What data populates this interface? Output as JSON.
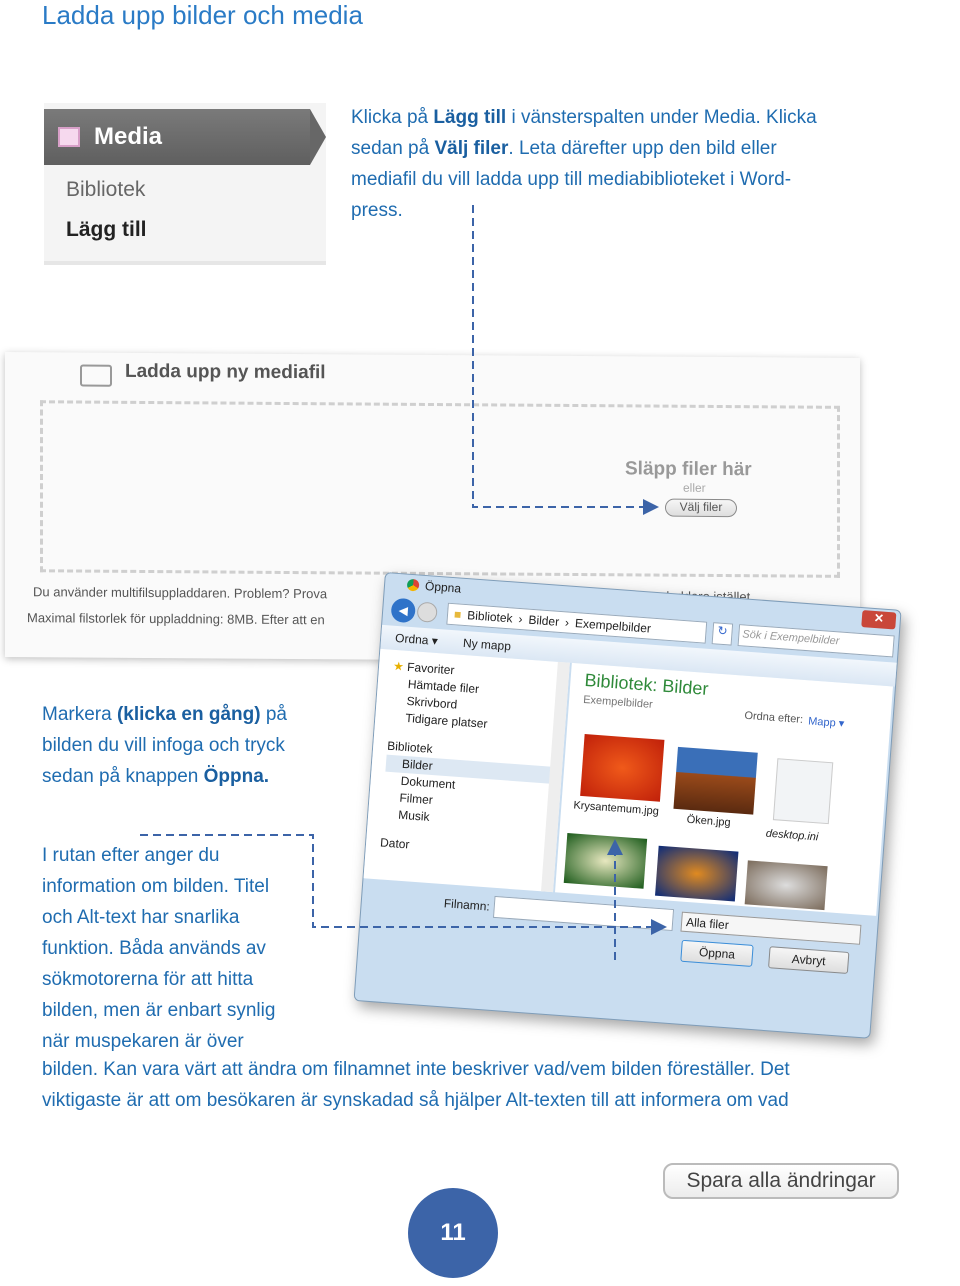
{
  "title": "Ladda upp bilder och media",
  "media_menu": {
    "header": "Media",
    "items": [
      "Bibliotek",
      "Lägg till"
    ]
  },
  "intro": {
    "t1": "Klicka på ",
    "b1": "Lägg till",
    "t2": " i vänsterspalten under Media. Klicka sedan på ",
    "b2": "Välj filer",
    "t3": ". Leta därefter upp den bild eller mediafil du vill ladda upp till mediabiblioteket i Word-press."
  },
  "upload": {
    "title": "Ladda upp ny mediafil",
    "drop": "Släpp filer här",
    "or": "eller",
    "select_button": "Välj filer",
    "note1": "Du använder multifilsuppladdaren. Problem? Prova",
    "note1_end": "...rens uppladdare istället.",
    "note2": "Maximal filstorlek för uppladdning: 8MB. Efter att en"
  },
  "dialog": {
    "title": "Öppna",
    "breadcrumb": [
      "Bibliotek",
      "Bilder",
      "Exempelbilder"
    ],
    "organize": "Ordna ▾",
    "new_folder": "Ny mapp",
    "search_placeholder": "Sök i Exempelbilder",
    "nav": {
      "favorites": "Favoriter",
      "fav_items": [
        "Hämtade filer",
        "Skrivbord",
        "Tidigare platser"
      ],
      "libraries": "Bibliotek",
      "lib_items": [
        "Bilder",
        "Dokument",
        "Filmer",
        "Musik"
      ],
      "computer": "Dator"
    },
    "library_title": "Bibliotek: Bilder",
    "library_sub": "Exempelbilder",
    "sort_label": "Ordna efter:",
    "sort_value": "Mapp ▾",
    "files": [
      "Krysantemum.jpg",
      "Öken.jpg",
      "desktop.ini"
    ],
    "filename_label": "Filnamn:",
    "filetype": "Alla filer",
    "open_button": "Öppna",
    "cancel_button": "Avbryt"
  },
  "step2": {
    "t1": "Markera ",
    "b1": "(klicka en gång)",
    "t2": " på bilden du vill infoga och tryck sedan på knappen ",
    "b2": "Öppna."
  },
  "step3": {
    "lines": [
      "I rutan efter anger du",
      "information om bilden. Titel",
      "och Alt-text har snarlika",
      "funktion. Båda används av",
      "sökmotorerna för att hitta",
      "bilden, men är enbart synlig",
      "när muspekaren är över"
    ],
    "full1": "bilden.  Kan vara värt att ändra om filnamnet inte beskriver vad/vem bilden föreställer. Det",
    "full2": "viktigaste är att om besökaren är synskadad så hjälper Alt-texten till att informera om vad"
  },
  "save_button": "Spara alla ändringar",
  "page_number": "11",
  "colors": {
    "text": "#1f6cb0",
    "page_badge": "#3c64a8",
    "connector": "#3c64a8"
  }
}
